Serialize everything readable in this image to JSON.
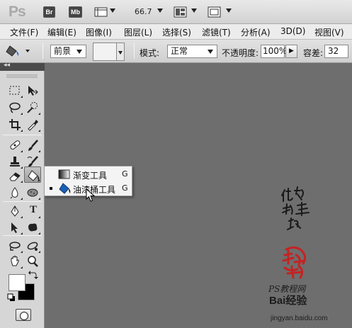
{
  "app": {
    "logo": "Ps",
    "bridge_label": "Br",
    "minibridge_label": "Mb",
    "zoom": "66.7"
  },
  "menu": [
    "文件(F)",
    "编辑(E)",
    "图像(I)",
    "图层(L)",
    "选择(S)",
    "滤镜(T)",
    "分析(A)",
    "3D(D)",
    "视图(V)"
  ],
  "options": {
    "fill_source": "前景",
    "mode_label": "模式:",
    "mode_value": "正常",
    "opacity_label": "不透明度:",
    "opacity_value": "100%",
    "tolerance_label": "容差:",
    "tolerance_value": "32"
  },
  "toolbox": {
    "collapse_glyph": "◂◂"
  },
  "flyout": {
    "items": [
      {
        "label": "渐变工具",
        "shortcut": "G",
        "active": false
      },
      {
        "label": "油漆桶工具",
        "shortcut": "G",
        "active": true
      }
    ]
  },
  "watermark": {
    "site_text": "PS教程网",
    "brand": "Bai经验",
    "url": "jingyan.baidu.com"
  },
  "colors": {
    "canvas": "#6e6e6e",
    "panel": "#d6d6d6",
    "seal": "#c42323"
  }
}
